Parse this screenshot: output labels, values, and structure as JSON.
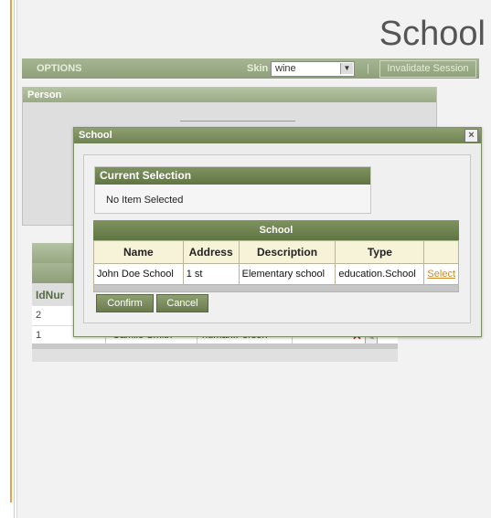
{
  "app": {
    "title": "School"
  },
  "options": {
    "label": "OPTIONS",
    "skin_label": "Skin",
    "skin_value": "wine",
    "invalidate_label": "Invalidate Session",
    "separator": "|"
  },
  "person_panel": {
    "title": "Person"
  },
  "background_table": {
    "column_header": "IdNur",
    "rows": [
      {
        "id": "2",
        "name": "",
        "type": ""
      },
      {
        "id": "1",
        "name": "Camilo Smith",
        "type": "human.Person"
      }
    ]
  },
  "dialog": {
    "title": "School",
    "current_selection": {
      "title": "Current Selection",
      "text": "No Item Selected"
    },
    "table": {
      "title": "School",
      "columns": [
        "Name",
        "Address",
        "Description",
        "Type",
        ""
      ],
      "rows": [
        {
          "name": "John Doe School",
          "address": "1 st",
          "description": "Elementary school",
          "type": "education.School",
          "action": "Select"
        }
      ]
    },
    "confirm_label": "Confirm",
    "cancel_label": "Cancel"
  },
  "colors": {
    "accent_green": "#6f8152",
    "select_link": "#d08a2a",
    "left_border": "#e8a343"
  }
}
